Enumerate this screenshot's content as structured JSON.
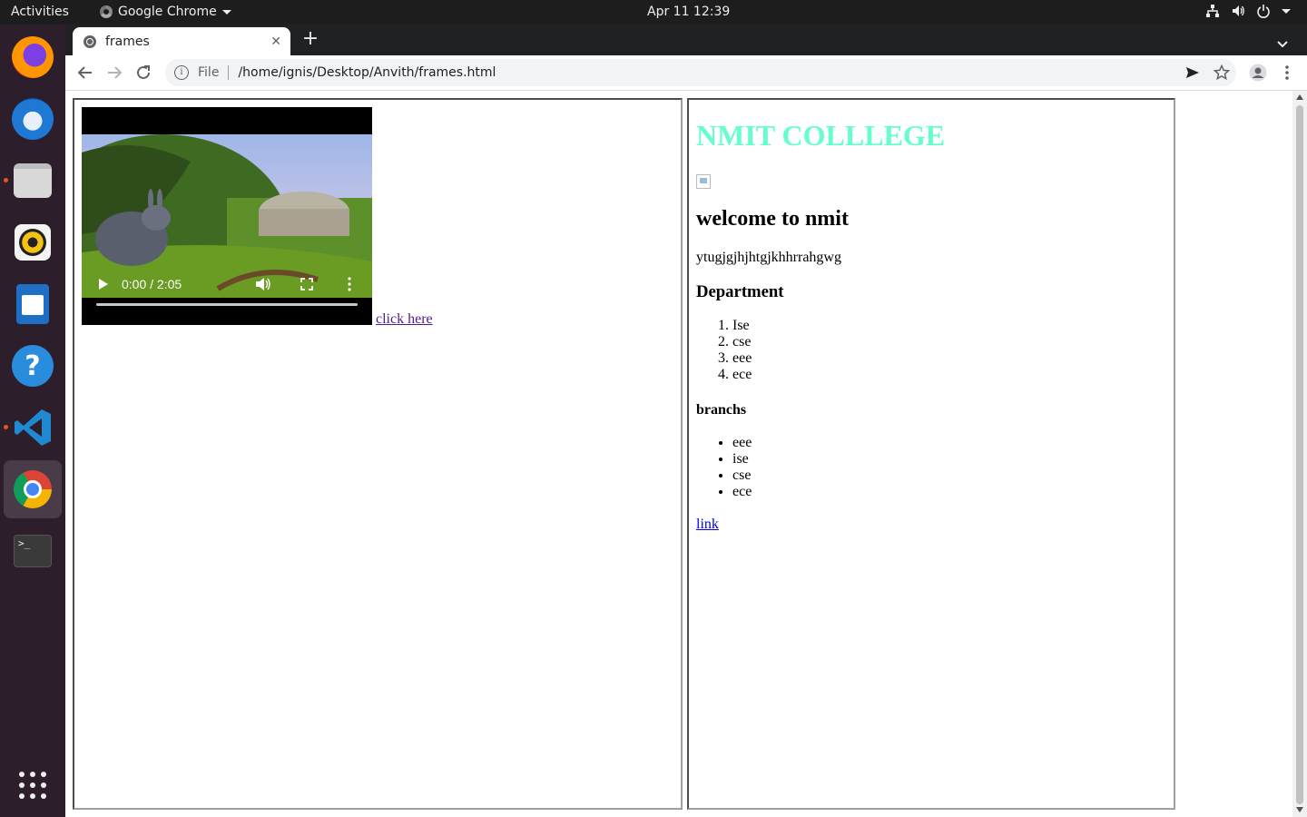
{
  "topbar": {
    "activities": "Activities",
    "app_name": "Google Chrome",
    "clock": "Apr 11  12:39"
  },
  "dock": {
    "items": [
      "firefox-icon",
      "thunderbird-icon",
      "files-icon",
      "rhythmbox-icon",
      "libreoffice-writer-icon",
      "help-icon",
      "vscode-icon",
      "chrome-icon",
      "terminal-icon"
    ],
    "show_apps_icon": "app-grid-icon"
  },
  "browser": {
    "tab_title": "frames",
    "url_scheme": "File",
    "url": "/home/ignis/Desktop/Anvith/frames.html"
  },
  "left_frame": {
    "video_time": "0:00 / 2:05",
    "video_progress_fraction": 0,
    "link_text": "click here"
  },
  "right_frame": {
    "heading": "NMIT COLLLEGE",
    "welcome": "welcome to nmit",
    "paragraph": "ytugjgjhjhtgjkhhrrahgwg",
    "department_heading": "Department",
    "departments": [
      "Ise",
      "cse",
      "eee",
      "ece"
    ],
    "branches_heading": "branchs",
    "branches": [
      "eee",
      "ise",
      "cse",
      "ece"
    ],
    "link_text": "link"
  },
  "colors": {
    "heading_color": "#66ffcc",
    "visited_link": "#551a8b",
    "link": "#0000ee",
    "accent_dot": "#e95420"
  }
}
